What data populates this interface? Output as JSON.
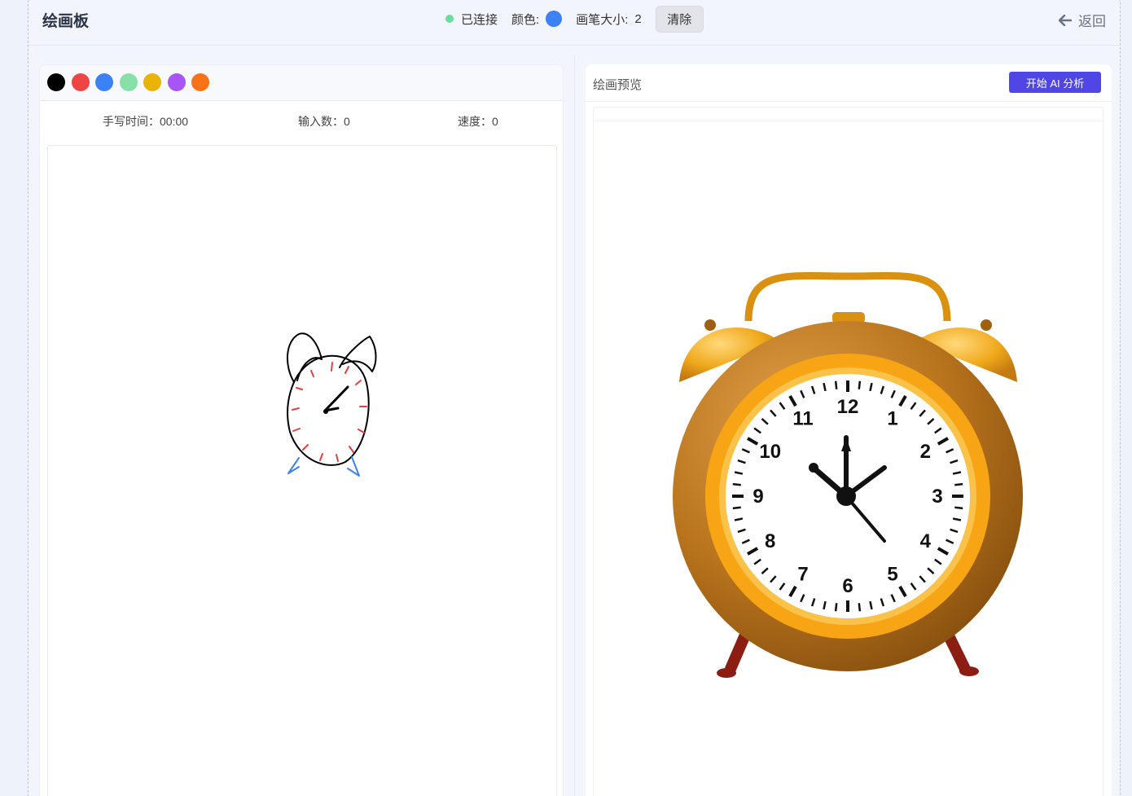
{
  "header": {
    "title": "绘画板",
    "status": "已连接",
    "color_label": "颜色:",
    "brush_label": "画笔大小:",
    "brush_size": "2",
    "clear_label": "清除",
    "back_label": "返回",
    "current_color": "#3b82f6",
    "status_color": "#6ddc9c"
  },
  "palette": [
    "#000000",
    "#ef4444",
    "#3b82f6",
    "#86e0a8",
    "#eab308",
    "#a855f7",
    "#f97316"
  ],
  "stats": {
    "time": "手写时间：00:00",
    "inputs": "输入数：0",
    "speed": "速度：0"
  },
  "preview": {
    "title": "绘画预览",
    "ai_button": "开始 AI 分析"
  },
  "clock_numerals": [
    "12",
    "1",
    "2",
    "3",
    "4",
    "5",
    "6",
    "7",
    "8",
    "9",
    "10",
    "11"
  ]
}
